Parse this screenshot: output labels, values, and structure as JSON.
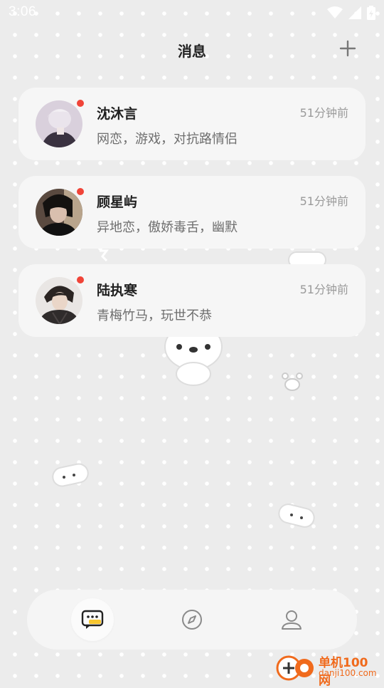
{
  "status_bar": {
    "time": "3:06"
  },
  "header": {
    "title": "消息",
    "add_icon": "plus-icon"
  },
  "conversations": [
    {
      "name": "沈沐言",
      "time": "51分钟前",
      "preview": "网恋，游戏，对抗路情侣",
      "unread": true
    },
    {
      "name": "顾星屿",
      "time": "51分钟前",
      "preview": "异地恋，傲娇毒舌，幽默",
      "unread": true
    },
    {
      "name": "陆执寒",
      "time": "51分钟前",
      "preview": "青梅竹马，玩世不恭",
      "unread": true
    }
  ],
  "tab_bar": {
    "tabs": [
      {
        "icon": "chat-bubble-icon",
        "active": true
      },
      {
        "icon": "compass-icon",
        "active": false
      },
      {
        "icon": "profile-icon",
        "active": false
      }
    ],
    "accent_color": "#f7c62f"
  },
  "watermark": {
    "name": "单机100网",
    "url": "danji100.com"
  },
  "colors": {
    "unread_dot": "#f04438",
    "background": "#ececec",
    "card": "#f6f6f6"
  }
}
